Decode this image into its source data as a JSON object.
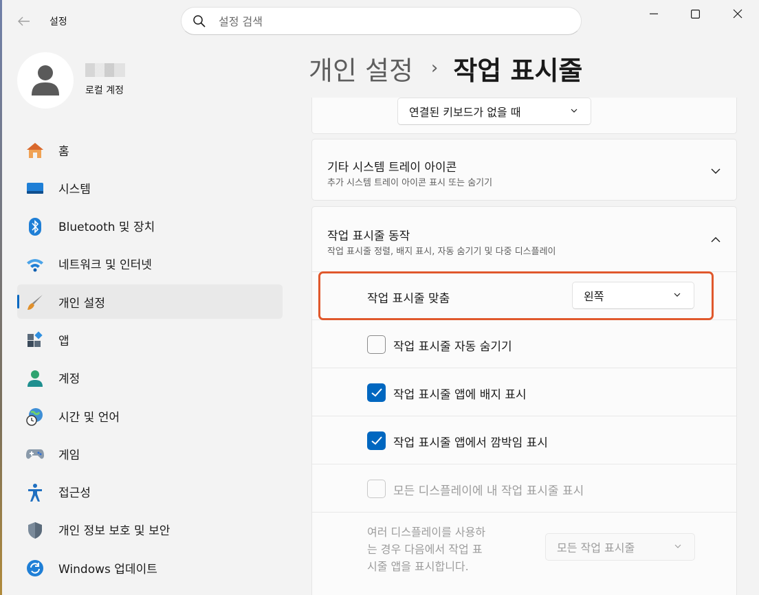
{
  "window": {
    "title": "설정",
    "back_icon": "arrow-left-icon",
    "controls": [
      "minimize-icon",
      "maximize-icon",
      "close-icon"
    ]
  },
  "search": {
    "placeholder": "설정 검색",
    "icon": "search-icon"
  },
  "profile": {
    "account_type": "로컬 계정"
  },
  "nav": {
    "items": [
      {
        "label": "홈",
        "icon": "home-icon"
      },
      {
        "label": "시스템",
        "icon": "system-icon"
      },
      {
        "label": "Bluetooth 및 장치",
        "icon": "bluetooth-icon"
      },
      {
        "label": "네트워크 및 인터넷",
        "icon": "wifi-icon"
      },
      {
        "label": "개인 설정",
        "icon": "brush-icon",
        "active": true
      },
      {
        "label": "앱",
        "icon": "apps-icon"
      },
      {
        "label": "계정",
        "icon": "account-icon"
      },
      {
        "label": "시간 및 언어",
        "icon": "time-language-icon"
      },
      {
        "label": "게임",
        "icon": "gamepad-icon"
      },
      {
        "label": "접근성",
        "icon": "accessibility-icon"
      },
      {
        "label": "개인 정보 보호 및 보안",
        "icon": "shield-icon"
      },
      {
        "label": "Windows 업데이트",
        "icon": "update-icon"
      }
    ]
  },
  "breadcrumb": {
    "parent": "개인 설정",
    "separator": "›",
    "current": "작업 표시줄"
  },
  "top_card": {
    "dropdown_value": "연결된 키보드가 없을 때"
  },
  "tray_card": {
    "title": "기타 시스템 트레이 아이콘",
    "subtitle": "추가 시스템 트레이 아이콘 표시 또는 숨기기"
  },
  "behaviors_card": {
    "title": "작업 표시줄 동작",
    "subtitle": "작업 표시줄 정렬, 배지 표시, 자동 숨기기 및 다중 디스플레이",
    "alignment": {
      "label": "작업 표시줄 맞춤",
      "value": "왼쪽"
    },
    "options": [
      {
        "label": "작업 표시줄 자동 숨기기",
        "checked": false,
        "disabled": false
      },
      {
        "label": "작업 표시줄 앱에 배지 표시",
        "checked": true,
        "disabled": false
      },
      {
        "label": "작업 표시줄 앱에서 깜박임 표시",
        "checked": true,
        "disabled": false
      },
      {
        "label": "모든 디스플레이에 내 작업 표시줄 표시",
        "checked": false,
        "disabled": true
      }
    ],
    "multi_display": {
      "label_lines": [
        "여러 디스플레이를 사용하",
        "는 경우 다음에서 작업 표",
        "시줄 앱을 표시합니다."
      ],
      "value": "모든 작업 표시줄",
      "disabled": true
    }
  },
  "colors": {
    "accent": "#0067c0",
    "highlight": "#e0582c",
    "background": "#f3f3f3",
    "card": "#fbfbfb"
  }
}
